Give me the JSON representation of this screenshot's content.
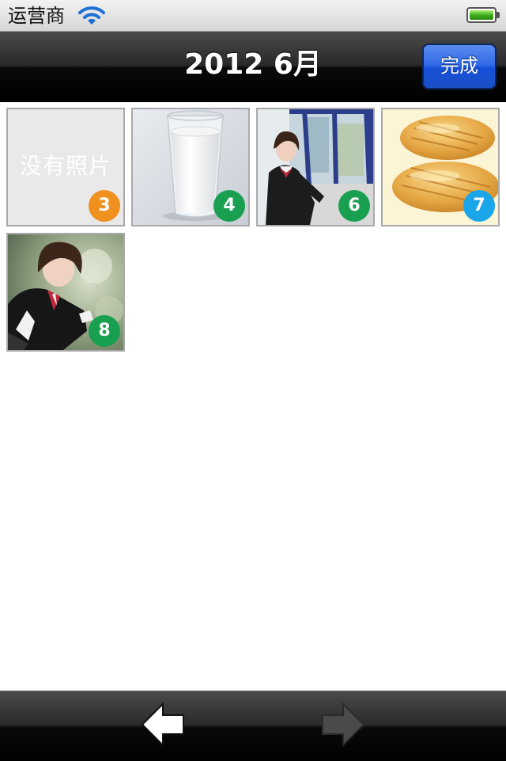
{
  "status_bar": {
    "carrier": "运营商",
    "wifi_icon": "wifi-icon",
    "battery_icon": "battery-full-icon"
  },
  "nav": {
    "title": "2012 6月",
    "done_label": "完成"
  },
  "grid": {
    "tiles": [
      {
        "kind": "empty",
        "text": "没有照片",
        "day": "3",
        "badge_color": "#f0901e"
      },
      {
        "kind": "photo",
        "subject": "glass of milk",
        "day": "4",
        "badge_color": "#18a050"
      },
      {
        "kind": "photo",
        "subject": "girl by window",
        "day": "6",
        "badge_color": "#18a050"
      },
      {
        "kind": "photo",
        "subject": "bread rolls",
        "day": "7",
        "badge_color": "#1aa6e8"
      },
      {
        "kind": "photo",
        "subject": "girl outdoors",
        "day": "8",
        "badge_color": "#18a050"
      }
    ]
  },
  "toolbar": {
    "prev_icon": "arrow-left-icon",
    "next_icon": "arrow-right-icon",
    "next_enabled": false
  }
}
